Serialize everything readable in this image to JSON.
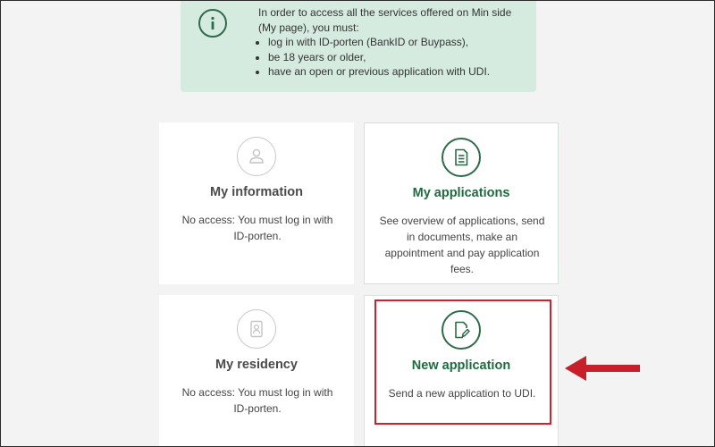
{
  "info": {
    "intro": "In order to access all the services offered on Min side (My page), you must:",
    "requirements": [
      "log in with ID-porten (BankID or Buypass),",
      "be 18 years or older,",
      "have an open or previous application with UDI."
    ],
    "icon": "info-icon"
  },
  "cards": [
    {
      "title": "My information",
      "description": "No access: You must log in with ID-porten.",
      "icon": "person-icon",
      "enabled": false
    },
    {
      "title": "My applications",
      "description": "See overview of applications, send in documents, make an appointment and pay application fees.",
      "icon": "document-list-icon",
      "enabled": true
    },
    {
      "title": "My residency",
      "description": "No access: You must log in with ID-porten.",
      "icon": "id-card-icon",
      "enabled": false
    },
    {
      "title": "New application",
      "description": "Send a new application to UDI.",
      "icon": "edit-document-icon",
      "enabled": true
    }
  ],
  "colors": {
    "accent": "#1f6b3f",
    "info_background": "#d6ebe0",
    "highlight": "#d0202c"
  }
}
